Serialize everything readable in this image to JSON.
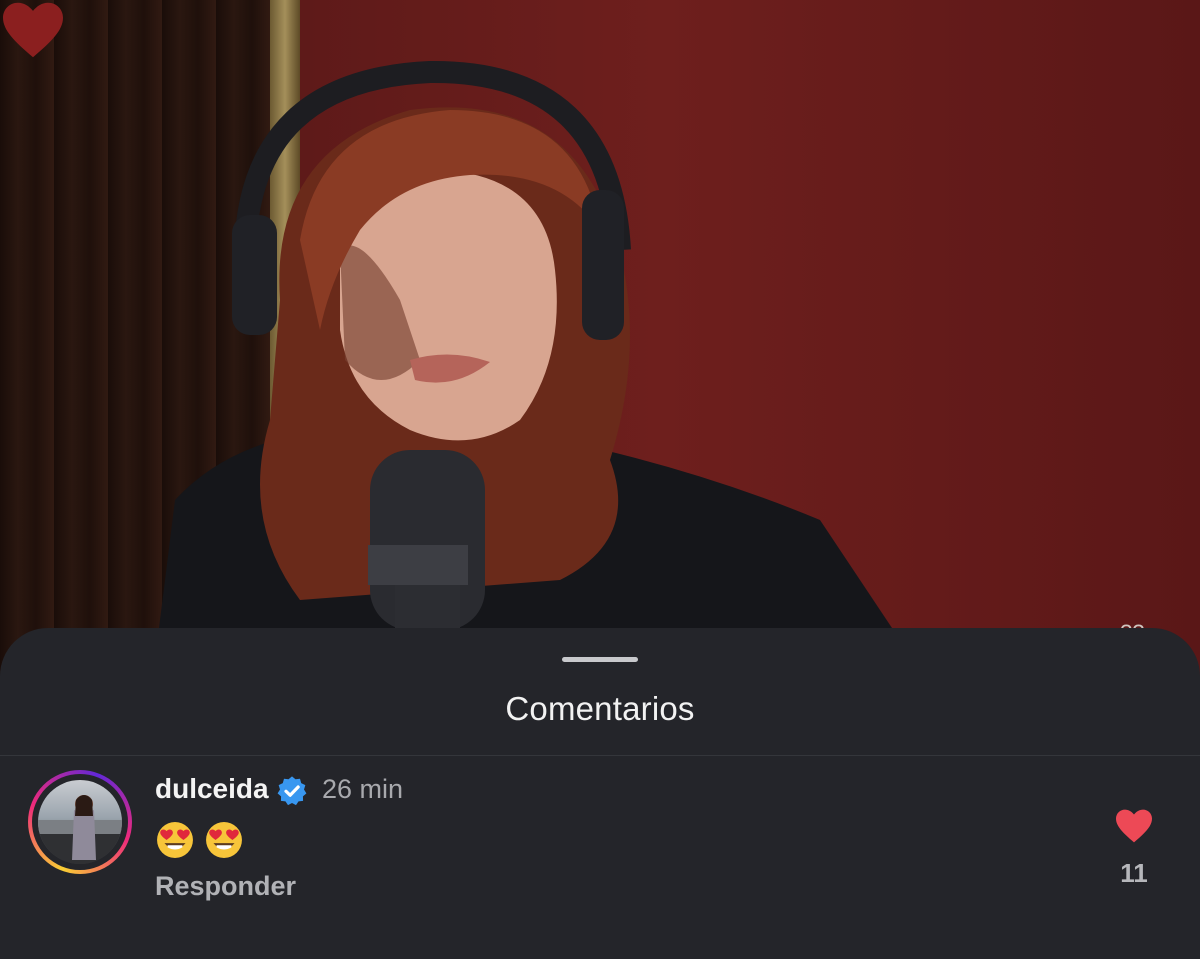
{
  "video": {
    "subject": "singer with headphones and microphone",
    "like_icon": "heart-icon",
    "like_count": "??",
    "colors": {
      "heart": "#8b1f1f",
      "background": "#6e1f1d"
    }
  },
  "sheet": {
    "title": "Comentarios"
  },
  "comment": {
    "username": "dulceida",
    "verified_icon": "verified-badge-icon",
    "time": "26 min",
    "emoji_text": "😍😍",
    "reply_label": "Responder",
    "like_icon": "heart-icon",
    "like_count": "11",
    "colors": {
      "like": "#ed4956",
      "verified": "#3897f0",
      "ring_start": "#f9ce34",
      "ring_end": "#6228d7"
    }
  }
}
